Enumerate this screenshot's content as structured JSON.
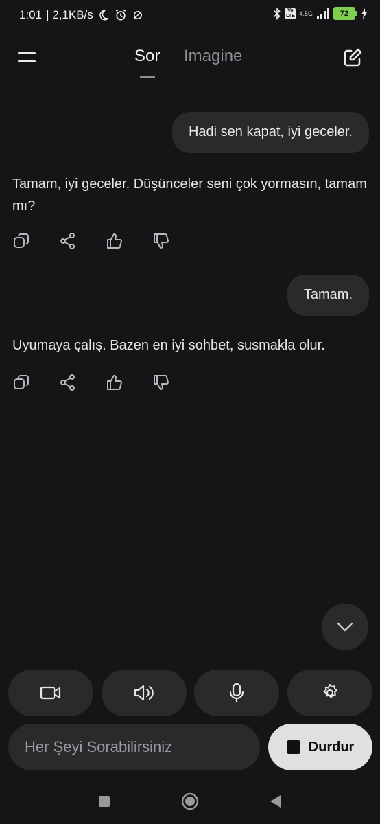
{
  "status_bar": {
    "time": "1:01",
    "net_speed": "| 2,1KB/s",
    "network_type": "4.5G",
    "volte": "Vo LTE",
    "battery_level": "72",
    "icons": [
      "moon-icon",
      "alarm-icon",
      "sync-off-icon",
      "bluetooth-icon",
      "volte-icon",
      "signal-icon",
      "battery-icon",
      "charging-icon"
    ]
  },
  "header": {
    "tabs": [
      {
        "label": "Sor",
        "active": true
      },
      {
        "label": "Imagine",
        "active": false
      }
    ],
    "icons": [
      "menu-icon",
      "edit-icon"
    ]
  },
  "conversation": [
    {
      "role": "user",
      "text": "Hadi sen kapat, iyi geceler."
    },
    {
      "role": "assistant",
      "text": "Tamam, iyi geceler. Düşünceler seni çok yormasın, tamam mı?"
    },
    {
      "role": "user",
      "text": "Tamam."
    },
    {
      "role": "assistant",
      "text": "Uyumaya çalış. Bazen en iyi sohbet, susmakla olur."
    }
  ],
  "message_actions": [
    "copy-icon",
    "share-icon",
    "thumbs-up-icon",
    "thumbs-down-icon"
  ],
  "controls": [
    "video-camera-icon",
    "speaker-icon",
    "microphone-icon",
    "settings-icon"
  ],
  "composer": {
    "placeholder": "Her Şeyi Sorabilirsiniz",
    "stop_label": "Durdur"
  },
  "colors": {
    "background": "#151517",
    "bubble": "#2a2a2d",
    "stop_button": "#e0e0e0",
    "battery": "#7fcf4e"
  }
}
